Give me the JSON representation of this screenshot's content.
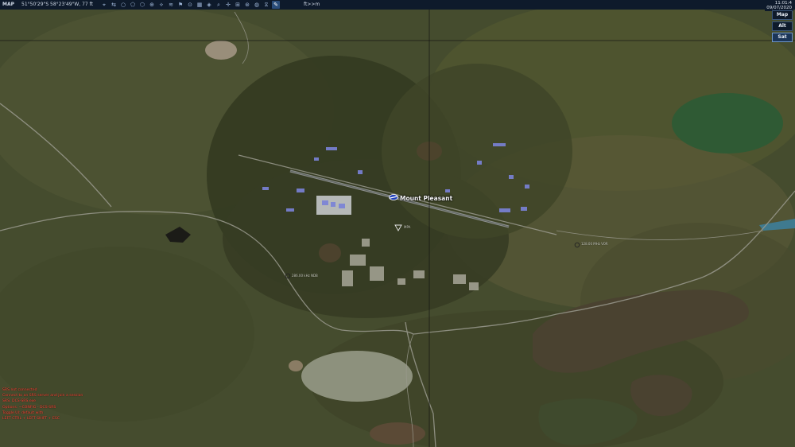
{
  "topbar": {
    "mode_label": "MAP",
    "coordinates": "51°50'29\"S 58°23'49\"W, 77 ft",
    "units_label": "ft>>m",
    "tools": [
      {
        "name": "cursor-icon",
        "glyph": "⌖"
      },
      {
        "name": "ruler-icon",
        "glyph": "⇆"
      },
      {
        "name": "circle-icon",
        "glyph": "○"
      },
      {
        "name": "polygon-icon",
        "glyph": "⬠"
      },
      {
        "name": "shape-icon",
        "glyph": "⬡"
      },
      {
        "name": "target-icon",
        "glyph": "⊕"
      },
      {
        "name": "waypoint-icon",
        "glyph": "⟡"
      },
      {
        "name": "signal-icon",
        "glyph": "≋"
      },
      {
        "name": "route-icon",
        "glyph": "⚑"
      },
      {
        "name": "marker-icon",
        "glyph": "⊙"
      },
      {
        "name": "grid-icon",
        "glyph": "▦"
      },
      {
        "name": "layers-icon",
        "glyph": "◈"
      },
      {
        "name": "search-icon",
        "glyph": "⌕"
      },
      {
        "name": "crosshair-icon",
        "glyph": "✛"
      },
      {
        "name": "zoom-in-icon",
        "glyph": "⊞"
      },
      {
        "name": "compass-icon",
        "glyph": "⊛"
      },
      {
        "name": "globe-icon",
        "glyph": "◍"
      },
      {
        "name": "filter-icon",
        "glyph": "⧖"
      },
      {
        "name": "pen-icon",
        "glyph": "✎"
      }
    ]
  },
  "clock": {
    "time": "11:01:4",
    "date": "09/07/2020"
  },
  "layers": [
    "Map",
    "Alt",
    "Sat"
  ],
  "active_layer": "Sat",
  "map": {
    "airfield_label": "Mount Pleasant",
    "small_labels": [
      {
        "name": "navaid-label",
        "text": "MPA"
      },
      {
        "name": "marker-label-west",
        "text": "286.00 kHz NDB"
      },
      {
        "name": "marker-label-east",
        "text": "128.00 MHz VOR"
      }
    ]
  },
  "status_messages": [
    "SRS not connected",
    "Connect to an SRS server and join a session",
    "SRS: DCS-SRS.exe",
    "Options: ~CONFIG - DCS-SRS",
    "Toggle UI: default with",
    "LEFT CTRL + LEFT SHIFT + ESC"
  ],
  "colors": {
    "status_text": "#ff4a3a",
    "toolbar_bg": "#0e1a2b",
    "satellite_base": "#3b4128"
  }
}
